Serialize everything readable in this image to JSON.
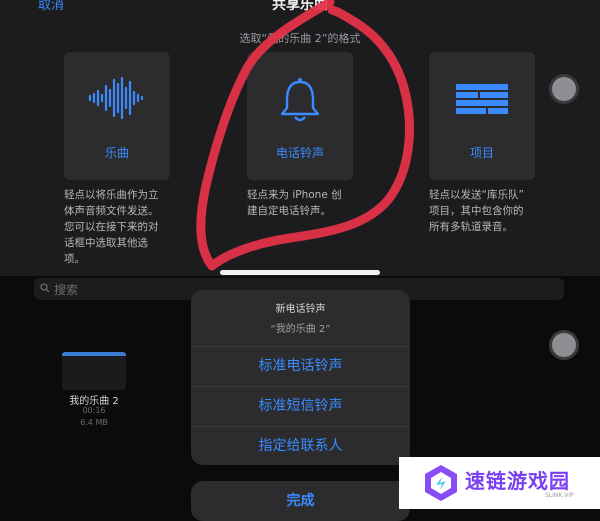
{
  "share_sheet": {
    "cancel_label": "取消",
    "title": "共享乐曲",
    "subtitle": "选取“我的乐曲 2”的格式",
    "options": [
      {
        "label": "乐曲",
        "icon": "waveform-icon",
        "description": "轻点以将乐曲作为立\n体声音频文件发送。\n您可以在接下来的对\n话框中选取其他选\n项。"
      },
      {
        "label": "电话铃声",
        "icon": "bell-icon",
        "description": "轻点来为 iPhone 创\n建自定电话铃声。"
      },
      {
        "label": "项目",
        "icon": "brick-wall-icon",
        "description": "轻点以发送“库乐队”\n项目，其中包含你的\n所有多轨道录音。"
      }
    ]
  },
  "library": {
    "search_placeholder": "搜索",
    "song": {
      "name": "我的乐曲 2",
      "duration": "00:16",
      "size": "6.4 MB"
    }
  },
  "action_sheet": {
    "title": "新电话铃声",
    "subtitle": "“我的乐曲 2”",
    "actions": [
      "标准电话铃声",
      "标准短信铃声",
      "指定给联系人"
    ],
    "done_label": "完成"
  },
  "watermark": {
    "title": "速链游戏园",
    "subtitle": "SLINK.VIP"
  },
  "colors": {
    "accent": "#3a8bff",
    "annotation": "#e8334a",
    "sheet_bg": "#1c1c1e",
    "card_bg": "#2c2c2e"
  }
}
